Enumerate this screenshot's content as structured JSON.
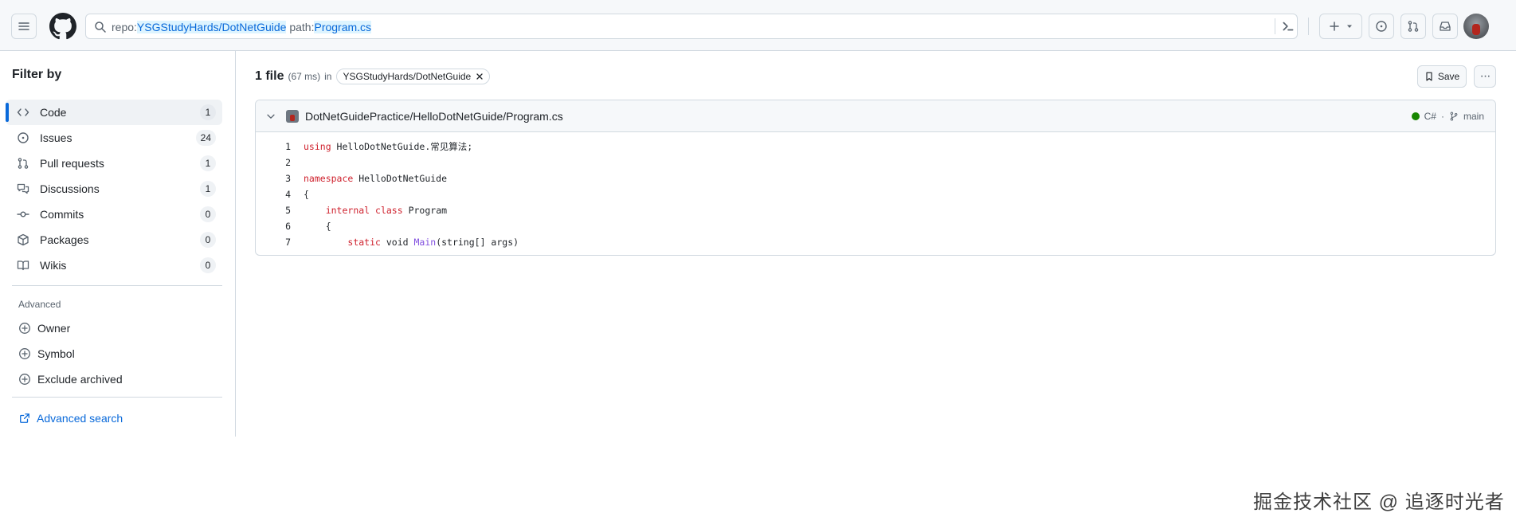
{
  "header": {
    "search_parts": [
      {
        "text": "repo:",
        "style": "plain"
      },
      {
        "text": "YSGStudyHards/DotNetGuide",
        "style": "query"
      },
      {
        "text": " path:",
        "style": "plain"
      },
      {
        "text": "Program.cs",
        "style": "query"
      }
    ],
    "icons": {
      "menu": "hamburger-icon",
      "logo": "github-logo",
      "search": "search-icon",
      "command": "terminal-icon",
      "create": "plus-icon",
      "issues": "issue-opened-icon",
      "pulls": "git-pull-request-icon",
      "inbox": "inbox-icon"
    }
  },
  "sidebar": {
    "title": "Filter by",
    "items": [
      {
        "label": "Code",
        "count": "1",
        "icon": "code-icon",
        "active": true
      },
      {
        "label": "Issues",
        "count": "24",
        "icon": "issue-opened-icon",
        "active": false
      },
      {
        "label": "Pull requests",
        "count": "1",
        "icon": "git-pull-request-icon",
        "active": false
      },
      {
        "label": "Discussions",
        "count": "1",
        "icon": "comment-discussion-icon",
        "active": false
      },
      {
        "label": "Commits",
        "count": "0",
        "icon": "git-commit-icon",
        "active": false
      },
      {
        "label": "Packages",
        "count": "0",
        "icon": "package-icon",
        "active": false
      },
      {
        "label": "Wikis",
        "count": "0",
        "icon": "book-icon",
        "active": false
      }
    ],
    "advanced_title": "Advanced",
    "advanced_items": [
      {
        "label": "Owner"
      },
      {
        "label": "Symbol"
      },
      {
        "label": "Exclude archived"
      }
    ],
    "advanced_search_label": "Advanced search"
  },
  "results": {
    "count_label": "1 file",
    "time_label": "(67 ms)",
    "in_label": "in",
    "repo_chip": "YSGStudyHards/DotNetGuide",
    "save_label": "Save",
    "more_label": "···"
  },
  "file": {
    "path": "DotNetGuidePractice/HelloDotNetGuide/Program.cs",
    "language": "C#",
    "separator": "·",
    "branch": "main",
    "language_color": "#178600",
    "lines": [
      {
        "num": "1",
        "tokens": [
          {
            "t": "using",
            "c": "kw"
          },
          {
            "t": " HelloDotNetGuide.常见算法;",
            "c": ""
          }
        ]
      },
      {
        "num": "2",
        "tokens": []
      },
      {
        "num": "3",
        "tokens": [
          {
            "t": "namespace",
            "c": "kw"
          },
          {
            "t": " HelloDotNetGuide",
            "c": ""
          }
        ]
      },
      {
        "num": "4",
        "tokens": [
          {
            "t": "{",
            "c": ""
          }
        ]
      },
      {
        "num": "5",
        "tokens": [
          {
            "t": "    ",
            "c": ""
          },
          {
            "t": "internal",
            "c": "kw"
          },
          {
            "t": " ",
            "c": ""
          },
          {
            "t": "class",
            "c": "kw"
          },
          {
            "t": " Program",
            "c": ""
          }
        ]
      },
      {
        "num": "6",
        "tokens": [
          {
            "t": "    {",
            "c": ""
          }
        ]
      },
      {
        "num": "7",
        "tokens": [
          {
            "t": "        ",
            "c": ""
          },
          {
            "t": "static",
            "c": "kw"
          },
          {
            "t": " void ",
            "c": ""
          },
          {
            "t": "Main",
            "c": "fn"
          },
          {
            "t": "(string[] args)",
            "c": ""
          }
        ]
      }
    ]
  },
  "watermark": "掘金技术社区 @ 追逐时光者",
  "colors": {
    "accent": "#0969da",
    "border": "#d1d9e0",
    "keyword": "#cf222e",
    "function": "#8250df"
  }
}
